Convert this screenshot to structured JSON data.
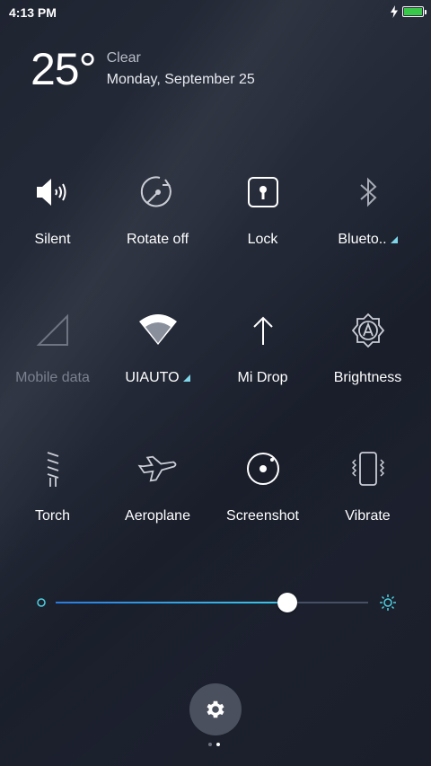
{
  "status_bar": {
    "time": "4:13 PM"
  },
  "weather": {
    "temperature": "25°",
    "condition": "Clear",
    "date": "Monday, September 25"
  },
  "tiles": [
    {
      "label": "Silent",
      "icon": "silent-icon",
      "active": true
    },
    {
      "label": "Rotate off",
      "icon": "rotate-icon",
      "active": true
    },
    {
      "label": "Lock",
      "icon": "lock-icon",
      "active": true
    },
    {
      "label": "Blueto..",
      "icon": "bluetooth-icon",
      "active": false
    },
    {
      "label": "Mobile data",
      "icon": "mobile-data-icon",
      "active": false
    },
    {
      "label": "UIAUTO",
      "icon": "wifi-icon",
      "active": true
    },
    {
      "label": "Mi Drop",
      "icon": "mi-drop-icon",
      "active": true
    },
    {
      "label": "Brightness",
      "icon": "auto-brightness-icon",
      "active": true
    },
    {
      "label": "Torch",
      "icon": "torch-icon",
      "active": true
    },
    {
      "label": "Aeroplane",
      "icon": "aeroplane-icon",
      "active": true
    },
    {
      "label": "Screenshot",
      "icon": "screenshot-icon",
      "active": true
    },
    {
      "label": "Vibrate",
      "icon": "vibrate-icon",
      "active": true
    }
  ],
  "brightness": {
    "level": 0.74
  },
  "colors": {
    "accent": "#3cc7e6",
    "battery": "#3ac84a",
    "background": "#232836"
  },
  "pager": {
    "pages": 2,
    "current": 2
  }
}
